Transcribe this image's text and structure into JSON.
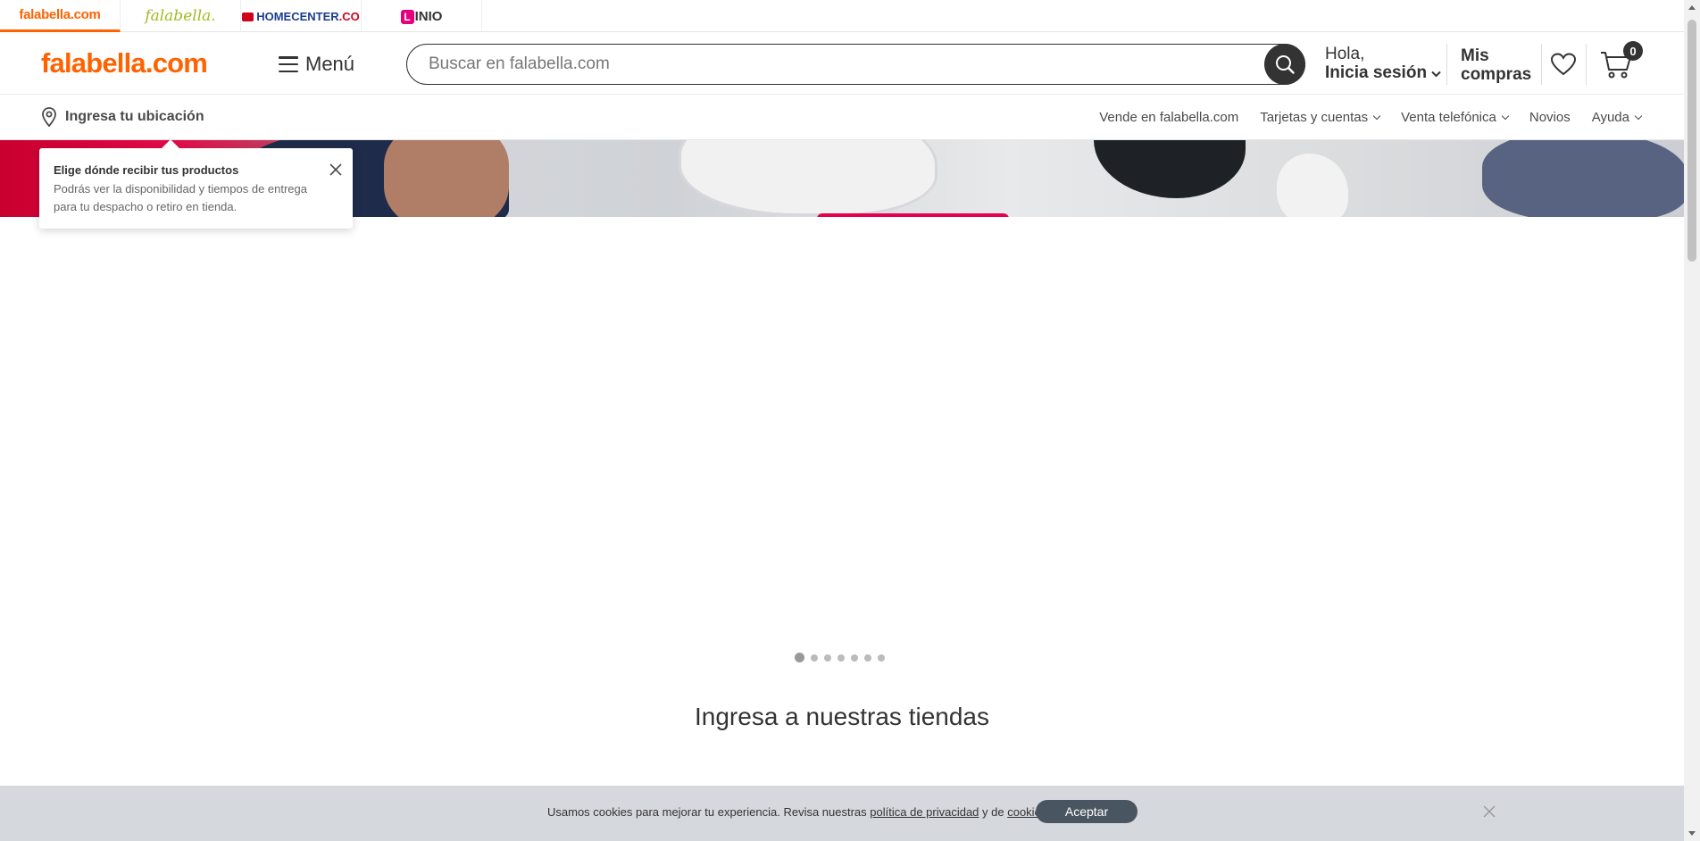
{
  "brands": [
    {
      "label": "falabella.com"
    },
    {
      "label": "falabella."
    },
    {
      "label_main": "HOMECENTER",
      "label_suffix": ".CO"
    },
    {
      "label_box": "L",
      "label_rest": "INIO"
    }
  ],
  "header": {
    "logo_main": "falabella.",
    "logo_suffix": "com",
    "menu_label": "Menú",
    "search_placeholder": "Buscar en falabella.com",
    "greeting_line1": "Hola,",
    "greeting_line2": "Inicia sesión",
    "purchases_line1": "Mis",
    "purchases_line2": "compras",
    "cart_count": "0"
  },
  "subnav": {
    "location_label": "Ingresa tu ubicación",
    "links": [
      {
        "label": "Vende en falabella.com"
      },
      {
        "label": "Tarjetas y cuentas"
      },
      {
        "label": "Venta telefónica"
      },
      {
        "label": "Novios"
      },
      {
        "label": "Ayuda"
      }
    ]
  },
  "location_popup": {
    "title": "Elige dónde recibir tus productos",
    "body": "Podrás ver la disponibilidad y tiempos de entrega para tu despacho o retiro en tienda."
  },
  "carousel": {
    "slide_count": 7,
    "active_slide": 1
  },
  "stores_title": "Ingresa a nuestras tiendas",
  "cookie_bar": {
    "text_before": "Usamos cookies para mejorar tu experiencia. Revisa nuestras ",
    "privacy_link": "política de privacidad",
    "text_middle": " y de ",
    "cookies_link": "cookies",
    "text_after": ".",
    "accept_label": "Aceptar"
  },
  "colors": {
    "brand": "#ff6200",
    "dark": "#333333",
    "cookie_bg": "#d5d8dd",
    "accept_bg": "#4a5562"
  }
}
